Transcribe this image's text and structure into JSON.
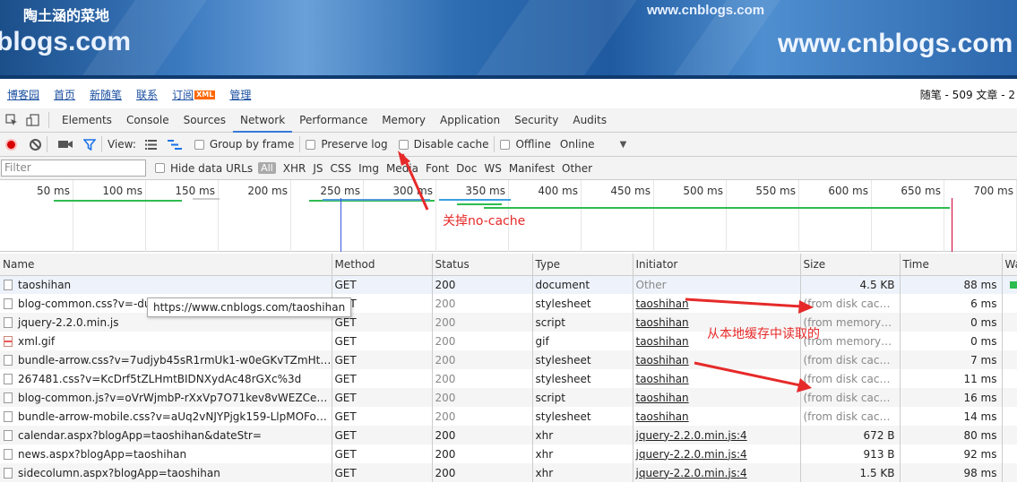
{
  "banner": {
    "blog_title": "陶土涵的菜地",
    "url_top": "www.cnblogs.com",
    "url_left": "blogs.com",
    "url_right": "www.cnblogs.com"
  },
  "blog_nav": {
    "items": [
      "博客园",
      "首页",
      "新随笔",
      "联系",
      "订阅",
      "管理"
    ],
    "xml_badge": "XML",
    "stats": "随笔 - 509  文章 - 2"
  },
  "devtools": {
    "tabs": [
      "Elements",
      "Console",
      "Sources",
      "Network",
      "Performance",
      "Memory",
      "Application",
      "Security",
      "Audits"
    ],
    "active_tab": "Network",
    "toolbar": {
      "view_label": "View:",
      "group_by_frame": "Group by frame",
      "preserve_log": "Preserve log",
      "disable_cache": "Disable cache",
      "offline": "Offline",
      "throttle": "Online"
    },
    "filter": {
      "placeholder": "Filter",
      "hide_data_urls": "Hide data URLs",
      "all": "All",
      "types": [
        "XHR",
        "JS",
        "CSS",
        "Img",
        "Media",
        "Font",
        "Doc",
        "WS",
        "Manifest",
        "Other"
      ]
    },
    "overview_ticks": [
      "50 ms",
      "100 ms",
      "150 ms",
      "200 ms",
      "250 ms",
      "300 ms",
      "350 ms",
      "400 ms",
      "450 ms",
      "500 ms",
      "550 ms",
      "600 ms",
      "650 ms",
      "700 ms"
    ],
    "columns": [
      "Name",
      "Method",
      "Status",
      "Type",
      "Initiator",
      "Size",
      "Time",
      "Wa"
    ],
    "rows": [
      {
        "name": "taoshihan",
        "method": "GET",
        "status": "200",
        "type": "document",
        "initiator": "Other",
        "size": "4.5 KB",
        "time": "88 ms"
      },
      {
        "name": "blog-common.css?v=-duj5v",
        "method": "GET",
        "status": "200",
        "type": "stylesheet",
        "initiator": "taoshihan",
        "size": "(from disk cache)",
        "time": "6 ms"
      },
      {
        "name": "jquery-2.2.0.min.js",
        "method": "GET",
        "status": "200",
        "type": "script",
        "initiator": "taoshihan",
        "size": "(from memory ca...",
        "time": "0 ms"
      },
      {
        "name": "xml.gif",
        "method": "GET",
        "status": "200",
        "type": "gif",
        "initiator": "taoshihan",
        "size": "(from memory ca...",
        "time": "0 ms"
      },
      {
        "name": "bundle-arrow.css?v=7udjyb45sR1rmUk1-w0eGKvTZmHt4_k2JE4...",
        "method": "GET",
        "status": "200",
        "type": "stylesheet",
        "initiator": "taoshihan",
        "size": "(from disk cache)",
        "time": "7 ms"
      },
      {
        "name": "267481.css?v=KcDrf5tZLHmtBIDNXydAc48rGXc%3d",
        "method": "GET",
        "status": "200",
        "type": "stylesheet",
        "initiator": "taoshihan",
        "size": "(from disk cache)",
        "time": "11 ms"
      },
      {
        "name": "blog-common.js?v=oVrWjmbP-rXxVp7O71kev8vWEZCetdwYalz...",
        "method": "GET",
        "status": "200",
        "type": "script",
        "initiator": "taoshihan",
        "size": "(from disk cache)",
        "time": "16 ms"
      },
      {
        "name": "bundle-arrow-mobile.css?v=aUq2vNJYPjgk159-LlpMOFotEnKR...",
        "method": "GET",
        "status": "200",
        "type": "stylesheet",
        "initiator": "taoshihan",
        "size": "(from disk cache)",
        "time": "14 ms"
      },
      {
        "name": "calendar.aspx?blogApp=taoshihan&dateStr=",
        "method": "GET",
        "status": "200",
        "type": "xhr",
        "initiator": "jquery-2.2.0.min.js:4",
        "size": "672 B",
        "time": "80 ms"
      },
      {
        "name": "news.aspx?blogApp=taoshihan",
        "method": "GET",
        "status": "200",
        "type": "xhr",
        "initiator": "jquery-2.2.0.min.js:4",
        "size": "913 B",
        "time": "92 ms"
      },
      {
        "name": "sidecolumn.aspx?blogApp=taoshihan",
        "method": "GET",
        "status": "200",
        "type": "xhr",
        "initiator": "jquery-2.2.0.min.js:4",
        "size": "1.5 KB",
        "time": "98 ms"
      }
    ],
    "tooltip": "https://www.cnblogs.com/taoshihan"
  },
  "annotations": {
    "no_cache": "关掉no-cache",
    "from_local_cache": "从本地缓存中读取的"
  },
  "colors": {
    "accent": "#3879d9",
    "record": "#d60000",
    "annotation": "#e62a2a"
  }
}
